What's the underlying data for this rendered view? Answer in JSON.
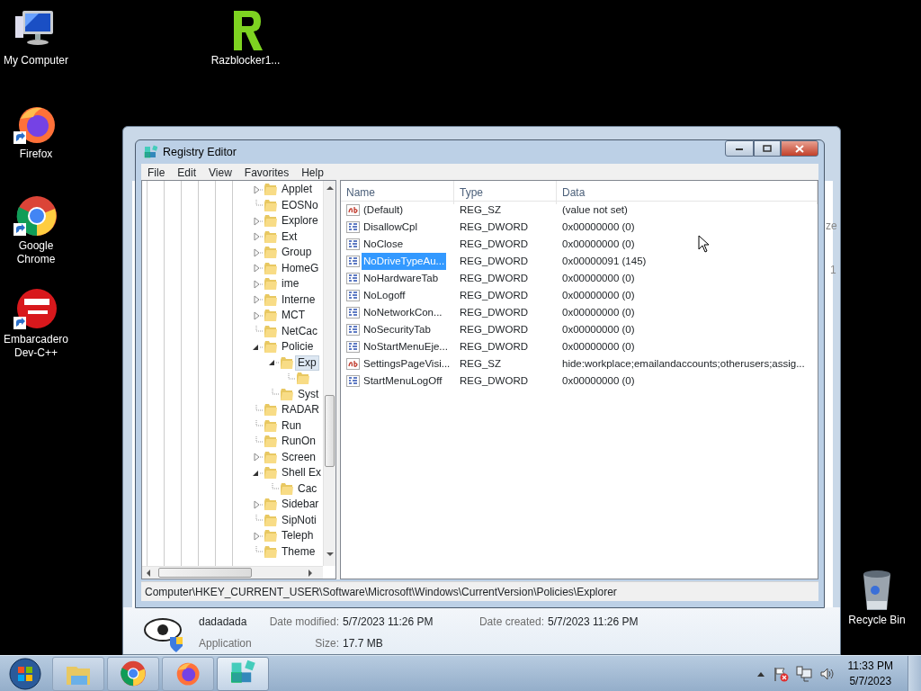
{
  "desktop_icons": [
    {
      "label": "My Computer",
      "kind": "computer",
      "shortcut": false
    },
    {
      "label": "Razblocker1...",
      "kind": "razblocker",
      "shortcut": false
    },
    {
      "label": "Firefox",
      "kind": "firefox",
      "shortcut": true
    },
    {
      "label": "Google Chrome",
      "kind": "chrome",
      "shortcut": true
    },
    {
      "label": "Embarcadero Dev-C++",
      "kind": "devcpp",
      "shortcut": true
    },
    {
      "label": "Recycle Bin",
      "kind": "recycle",
      "shortcut": false
    }
  ],
  "background_window": {
    "fragments": [
      "ze",
      "1"
    ],
    "details": {
      "name": "dadadada",
      "type": "Application",
      "date_modified_label": "Date modified:",
      "date_modified": "5/7/2023 11:26 PM",
      "date_created_label": "Date created:",
      "date_created": "5/7/2023 11:26 PM",
      "size_label": "Size:",
      "size": "17.7 MB"
    }
  },
  "regedit": {
    "title": "Registry Editor",
    "menu": [
      "File",
      "Edit",
      "View",
      "Favorites",
      "Help"
    ],
    "tree": [
      {
        "label": "Applet",
        "expandable": true,
        "expanded": false,
        "selected": false
      },
      {
        "label": "EOSNo",
        "expandable": false,
        "selected": false
      },
      {
        "label": "Explore",
        "expandable": true,
        "expanded": false,
        "selected": false
      },
      {
        "label": "Ext",
        "expandable": true,
        "expanded": false,
        "selected": false
      },
      {
        "label": "Group",
        "expandable": true,
        "expanded": false,
        "selected": false
      },
      {
        "label": "HomeG",
        "expandable": true,
        "expanded": false,
        "selected": false
      },
      {
        "label": "ime",
        "expandable": true,
        "expanded": false,
        "selected": false
      },
      {
        "label": "Interne",
        "expandable": true,
        "expanded": false,
        "selected": false
      },
      {
        "label": "MCT",
        "expandable": true,
        "expanded": false,
        "selected": false
      },
      {
        "label": "NetCac",
        "expandable": false,
        "selected": false
      },
      {
        "label": "Policie",
        "expandable": true,
        "expanded": true,
        "selected": false,
        "children": [
          {
            "label": "Exp",
            "expandable": true,
            "expanded": true,
            "selected": true,
            "children": [
              {
                "expandable": false,
                "selected": false
              }
            ]
          },
          {
            "label": "Syst",
            "expandable": false,
            "selected": false
          }
        ]
      },
      {
        "label": "RADAR",
        "expandable": false,
        "selected": false
      },
      {
        "label": "Run",
        "expandable": false,
        "selected": false
      },
      {
        "label": "RunOn",
        "expandable": false,
        "selected": false
      },
      {
        "label": "Screen",
        "expandable": true,
        "expanded": false,
        "selected": false
      },
      {
        "label": "Shell Ex",
        "expandable": true,
        "expanded": true,
        "selected": false,
        "children": [
          {
            "label": "Cac",
            "expandable": false,
            "selected": false
          }
        ]
      },
      {
        "label": "Sidebar",
        "expandable": true,
        "expanded": false,
        "selected": false
      },
      {
        "label": "SipNoti",
        "expandable": false,
        "selected": false
      },
      {
        "label": "Teleph",
        "expandable": true,
        "expanded": false,
        "selected": false
      },
      {
        "label": "Theme",
        "expandable": false,
        "selected": false
      }
    ],
    "columns": [
      "Name",
      "Type",
      "Data"
    ],
    "values": [
      {
        "name": "(Default)",
        "type": "REG_SZ",
        "data": "(value not set)",
        "kind": "string",
        "selected": false
      },
      {
        "name": "DisallowCpl",
        "type": "REG_DWORD",
        "data": "0x00000000 (0)",
        "kind": "binary",
        "selected": false
      },
      {
        "name": "NoClose",
        "type": "REG_DWORD",
        "data": "0x00000000 (0)",
        "kind": "binary",
        "selected": false
      },
      {
        "name": "NoDriveTypeAu...",
        "type": "REG_DWORD",
        "data": "0x00000091 (145)",
        "kind": "binary",
        "selected": true
      },
      {
        "name": "NoHardwareTab",
        "type": "REG_DWORD",
        "data": "0x00000000 (0)",
        "kind": "binary",
        "selected": false
      },
      {
        "name": "NoLogoff",
        "type": "REG_DWORD",
        "data": "0x00000000 (0)",
        "kind": "binary",
        "selected": false
      },
      {
        "name": "NoNetworkCon...",
        "type": "REG_DWORD",
        "data": "0x00000000 (0)",
        "kind": "binary",
        "selected": false
      },
      {
        "name": "NoSecurityTab",
        "type": "REG_DWORD",
        "data": "0x00000000 (0)",
        "kind": "binary",
        "selected": false
      },
      {
        "name": "NoStartMenuEje...",
        "type": "REG_DWORD",
        "data": "0x00000000 (0)",
        "kind": "binary",
        "selected": false
      },
      {
        "name": "SettingsPageVisi...",
        "type": "REG_SZ",
        "data": "hide:workplace;emailandaccounts;otherusers;assig...",
        "kind": "string",
        "selected": false
      },
      {
        "name": "StartMenuLogOff",
        "type": "REG_DWORD",
        "data": "0x00000000 (0)",
        "kind": "binary",
        "selected": false
      }
    ],
    "status": "Computer\\HKEY_CURRENT_USER\\Software\\Microsoft\\Windows\\CurrentVersion\\Policies\\Explorer"
  },
  "taskbar": {
    "buttons": [
      {
        "kind": "explorer",
        "active": false
      },
      {
        "kind": "chrome",
        "active": false
      },
      {
        "kind": "firefox",
        "active": false
      },
      {
        "kind": "regedit",
        "active": true
      }
    ],
    "clock": {
      "time": "11:33 PM",
      "date": "5/7/2023"
    }
  }
}
